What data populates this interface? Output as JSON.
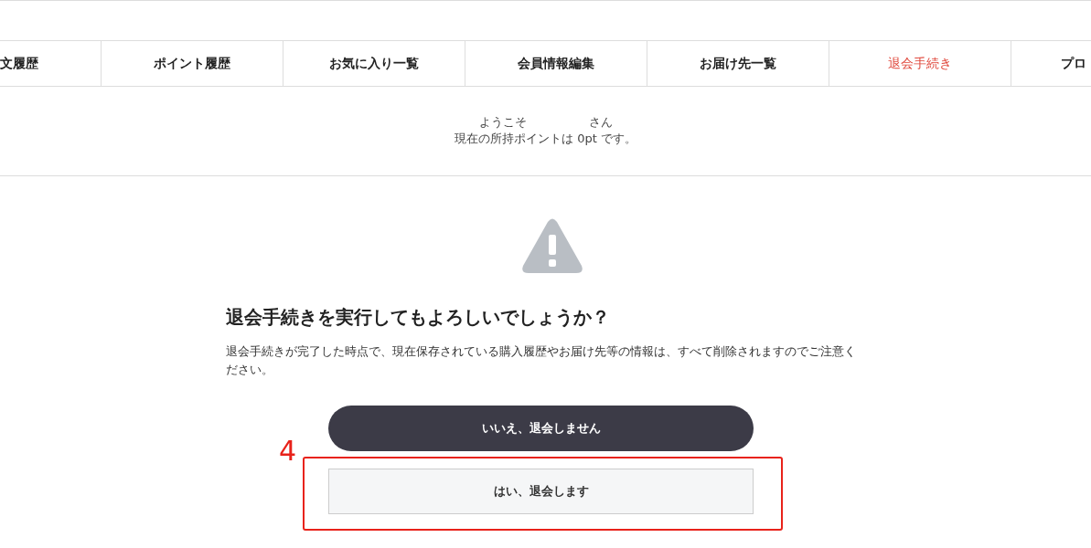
{
  "tabs": [
    {
      "label": "文履歴",
      "selected": false
    },
    {
      "label": "ポイント履歴",
      "selected": false
    },
    {
      "label": "お気に入り一覧",
      "selected": false
    },
    {
      "label": "会員情報編集",
      "selected": false
    },
    {
      "label": "お届け先一覧",
      "selected": false
    },
    {
      "label": "退会手続き",
      "selected": true
    },
    {
      "label": "プロ",
      "selected": false
    }
  ],
  "welcome": {
    "greeting": "ようこそ",
    "honorific": "さん",
    "points_line": "現在の所持ポイントは 0pt です。"
  },
  "confirm": {
    "heading": "退会手続きを実行してもよろしいでしょうか？",
    "message": "退会手続きが完了した時点で、現在保存されている購入履歴やお届け先等の情報は、すべて削除されますのでご注意ください。",
    "buttons": [
      {
        "label": "いいえ、退会しません",
        "kind": "primary"
      },
      {
        "label": "はい、退会します",
        "kind": "secondary"
      }
    ]
  },
  "annotation": {
    "label": "4"
  }
}
